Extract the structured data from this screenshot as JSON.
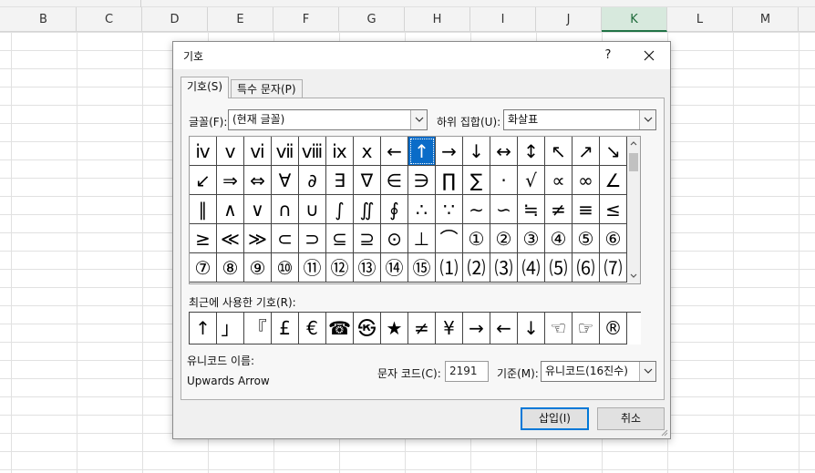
{
  "spreadsheet": {
    "columns": [
      {
        "label": "B",
        "selected": false
      },
      {
        "label": "C",
        "selected": false
      },
      {
        "label": "D",
        "selected": false
      },
      {
        "label": "E",
        "selected": false
      },
      {
        "label": "F",
        "selected": false
      },
      {
        "label": "G",
        "selected": false
      },
      {
        "label": "H",
        "selected": false
      },
      {
        "label": "I",
        "selected": false
      },
      {
        "label": "J",
        "selected": false
      },
      {
        "label": "K",
        "selected": true
      },
      {
        "label": "L",
        "selected": false
      },
      {
        "label": "M",
        "selected": false
      }
    ]
  },
  "dialog": {
    "title": "기호",
    "help": "?",
    "tabs": [
      {
        "label": "기호(S)",
        "active": true
      },
      {
        "label": "특수 문자(P)",
        "active": false
      }
    ],
    "font_label": "글꼴(F):",
    "font_value": "(현재 글꼴)",
    "subset_label": "하위 집합(U):",
    "subset_value": "화살표",
    "symbols": [
      [
        "ⅳ",
        "ⅴ",
        "ⅵ",
        "ⅶ",
        "ⅷ",
        "ⅸ",
        "ⅹ",
        "←",
        "↑",
        "→",
        "↓",
        "↔",
        "↕",
        "↖",
        "↗",
        "↘"
      ],
      [
        "↙",
        "⇒",
        "⇔",
        "∀",
        "∂",
        "∃",
        "∇",
        "∈",
        "∋",
        "∏",
        "∑",
        "·",
        "√",
        "∝",
        "∞",
        "∠"
      ],
      [
        "∥",
        "∧",
        "∨",
        "∩",
        "∪",
        "∫",
        "∬",
        "∮",
        "∴",
        "∵",
        "∼",
        "∽",
        "≒",
        "≠",
        "≡",
        "≤"
      ],
      [
        "≥",
        "≪",
        "≫",
        "⊂",
        "⊃",
        "⊆",
        "⊇",
        "⊙",
        "⊥",
        "⌒",
        "①",
        "②",
        "③",
        "④",
        "⑤",
        "⑥"
      ],
      [
        "⑦",
        "⑧",
        "⑨",
        "⑩",
        "⑪",
        "⑫",
        "⑬",
        "⑭",
        "⑮",
        "⑴",
        "⑵",
        "⑶",
        "⑷",
        "⑸",
        "⑹",
        "⑺"
      ]
    ],
    "selected_symbol": "↑",
    "recent_label": "최근에 사용한 기호(R):",
    "recent_symbols": [
      "↑",
      "」",
      "『",
      "£",
      "€",
      "☎",
      "㉿",
      "★",
      "≠",
      "¥",
      "→",
      "←",
      "↓",
      "☜",
      "☞",
      "®"
    ],
    "unicode_name_label": "유니코드 이름:",
    "unicode_name": "Upwards Arrow",
    "char_code_label": "문자 코드(C):",
    "char_code": "2191",
    "from_label": "기준(M):",
    "from_value": "유니코드(16진수)",
    "insert_label": "삽입(I)",
    "cancel_label": "취소"
  }
}
